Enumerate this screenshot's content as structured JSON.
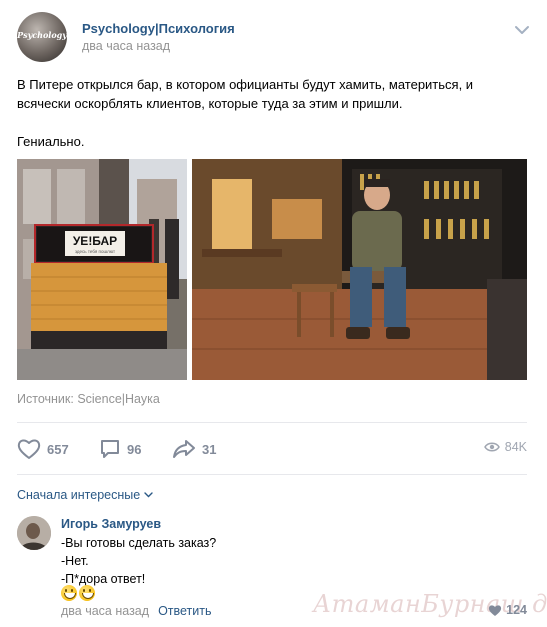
{
  "post": {
    "author": "Psychology|Психология",
    "avatar_text": "Psychology",
    "time": "два часа назад",
    "text_line_1": "В Питере открылся бар, в котором официанты будут хамить, материться, и",
    "text_line_2": "всячески оскорблять клиентов, которые туда за этим и пришли.",
    "text_line_3": "Гениально.",
    "photo_1_sign_title": "УЕ!БАР",
    "photo_1_sign_subtitle": "здесь тебя пошлют",
    "source_label": "Источник: ",
    "source_link": "Science|Наука"
  },
  "actions": {
    "likes": "657",
    "comments": "96",
    "shares": "31",
    "views": "84K"
  },
  "comments_section": {
    "sort_label": "Сначала интересные"
  },
  "comment": {
    "author": "Игорь Замуруев",
    "lines": [
      "-Вы готовы сделать заказ?",
      "-Нет.",
      "-П*дора ответ!"
    ],
    "time": "два часа назад",
    "reply_label": "Ответить",
    "likes": "124"
  },
  "watermark": "АтаманБурнаш для ЯП",
  "colors": {
    "link": "#2a5885",
    "muted": "#939393",
    "action": "#828a99",
    "divider": "#e7e8ec"
  },
  "icons": [
    "chevron-down-icon",
    "heart-icon",
    "comment-icon",
    "share-icon",
    "eye-icon"
  ]
}
